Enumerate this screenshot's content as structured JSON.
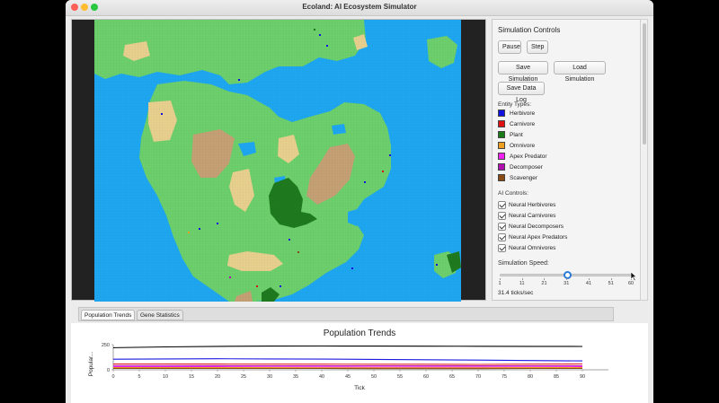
{
  "window": {
    "title": "Ecoland: AI Ecosystem Simulator"
  },
  "colors": {
    "water": "#1ea7f0",
    "grass": "#6ccf6c",
    "sand": "#e7cf8e",
    "mountain": "#c4a074",
    "forest": "#1f7a1f"
  },
  "controls": {
    "title": "Simulation Controls",
    "pause_label": "Pause",
    "step_label": "Step",
    "save_sim_label": "Save Simulation",
    "load_sim_label": "Load Simulation",
    "save_log_label": "Save Data Log",
    "entity_types_label": "Entity Types:",
    "entities": [
      {
        "label": "Herbivore",
        "color": "#1010e0"
      },
      {
        "label": "Carnivore",
        "color": "#e01010"
      },
      {
        "label": "Plant",
        "color": "#1a7a1a"
      },
      {
        "label": "Omnivore",
        "color": "#f0a020"
      },
      {
        "label": "Apex Predator",
        "color": "#f020f0"
      },
      {
        "label": "Decomposer",
        "color": "#b010b0"
      },
      {
        "label": "Scavenger",
        "color": "#8a4a14"
      }
    ],
    "ai_controls_label": "AI Controls:",
    "ai_toggles": [
      {
        "label": "Neural Herbivores",
        "checked": true
      },
      {
        "label": "Neural Carnivores",
        "checked": true
      },
      {
        "label": "Neural Decomposers",
        "checked": true
      },
      {
        "label": "Neural Apex Predators",
        "checked": true
      },
      {
        "label": "Neural Omnivores",
        "checked": true
      }
    ],
    "speed_label": "Simulation Speed:",
    "speed_ticks": [
      "1",
      "11",
      "21",
      "31",
      "41",
      "51",
      "60"
    ],
    "speed_value": 31.4,
    "speed_min": 1,
    "speed_max": 60,
    "speed_text": "31.4 ticks/sec"
  },
  "tabs": [
    {
      "label": "Population Trends",
      "active": true
    },
    {
      "label": "Gene Statistics",
      "active": false
    }
  ],
  "chart_data": {
    "type": "line",
    "title": "Population Trends",
    "xlabel": "Tick",
    "ylabel": "Popular...",
    "xlim": [
      0,
      95
    ],
    "ylim": [
      0,
      250
    ],
    "x_ticks": [
      "0",
      "5",
      "10",
      "15",
      "20",
      "25",
      "30",
      "35",
      "40",
      "45",
      "50",
      "55",
      "60",
      "65",
      "70",
      "75",
      "80",
      "85",
      "90"
    ],
    "y_ticks": [
      "250",
      "0"
    ],
    "grid": false,
    "series": [
      {
        "color": "#000000",
        "x": [
          0,
          10,
          20,
          30,
          40,
          50,
          60,
          70,
          80,
          90
        ],
        "values": [
          220,
          228,
          233,
          236,
          237,
          236,
          235,
          234,
          233,
          232
        ]
      },
      {
        "color": "#1a1ae0",
        "x": [
          0,
          10,
          20,
          30,
          40,
          50,
          60,
          70,
          80,
          90
        ],
        "values": [
          105,
          108,
          110,
          108,
          106,
          104,
          100,
          96,
          92,
          88
        ]
      },
      {
        "color": "#e02020",
        "x": [
          0,
          10,
          20,
          30,
          40,
          50,
          60,
          70,
          80,
          90
        ],
        "values": [
          58,
          58,
          57,
          56,
          56,
          55,
          55,
          54,
          56,
          58
        ]
      },
      {
        "color": "#c020c0",
        "x": [
          0,
          10,
          20,
          30,
          40,
          50,
          60,
          70,
          80,
          90
        ],
        "values": [
          42,
          42,
          41,
          40,
          40,
          40,
          39,
          39,
          40,
          40
        ]
      },
      {
        "color": "#f020f0",
        "x": [
          0,
          10,
          20,
          30,
          40,
          50,
          60,
          70,
          80,
          90
        ],
        "values": [
          30,
          30,
          30,
          29,
          29,
          28,
          28,
          28,
          29,
          30
        ]
      },
      {
        "color": "#f0a020",
        "x": [
          0,
          10,
          20,
          30,
          40,
          50,
          60,
          70,
          80,
          90
        ],
        "values": [
          22,
          22,
          21,
          21,
          20,
          20,
          20,
          20,
          21,
          21
        ]
      },
      {
        "color": "#8a4a14",
        "x": [
          0,
          10,
          20,
          30,
          40,
          50,
          60,
          70,
          80,
          90
        ],
        "values": [
          14,
          14,
          13,
          13,
          13,
          12,
          12,
          12,
          13,
          13
        ]
      }
    ]
  }
}
